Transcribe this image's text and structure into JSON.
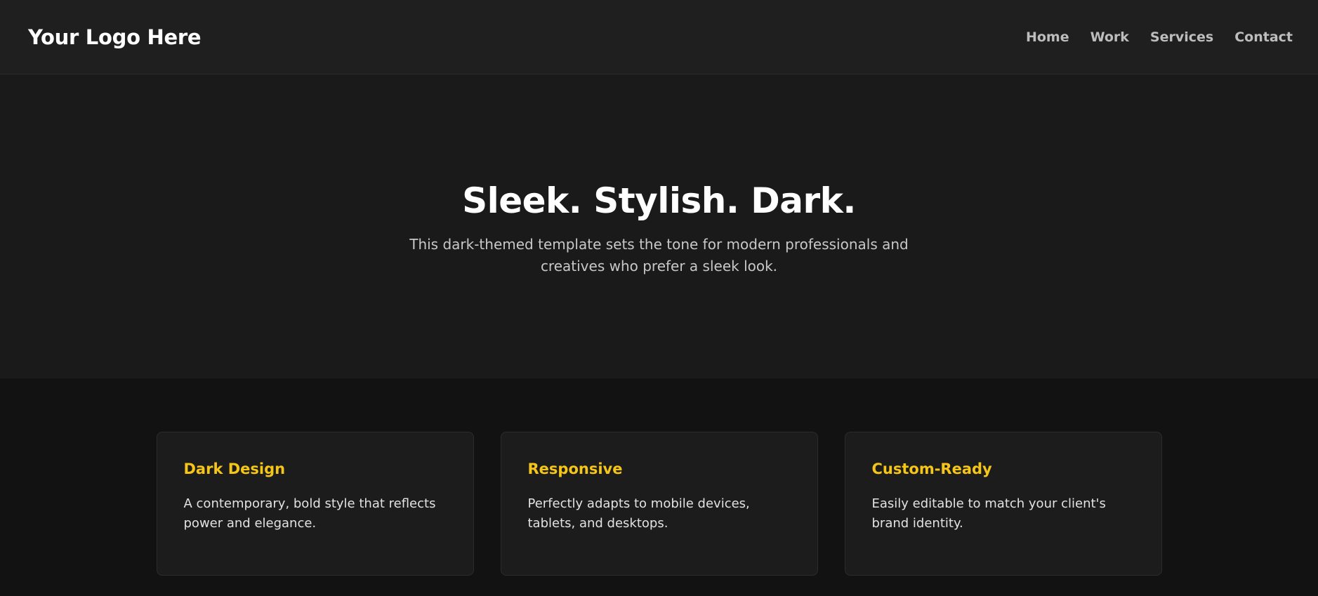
{
  "header": {
    "logo": "Your Logo Here",
    "nav": [
      {
        "label": "Home"
      },
      {
        "label": "Work"
      },
      {
        "label": "Services"
      },
      {
        "label": "Contact"
      }
    ]
  },
  "hero": {
    "title": "Sleek. Stylish. Dark.",
    "subtitle": "This dark-themed template sets the tone for modern professionals and creatives who prefer a sleek look."
  },
  "features": [
    {
      "title": "Dark Design",
      "text": "A contemporary, bold style that reflects power and elegance."
    },
    {
      "title": "Responsive",
      "text": "Perfectly adapts to mobile devices, tablets, and desktops."
    },
    {
      "title": "Custom-Ready",
      "text": "Easily editable to match your client's brand identity."
    }
  ],
  "colors": {
    "accent": "#f5c518",
    "header_bg": "#1f1f1f",
    "hero_bg": "#1a1a1a",
    "page_bg": "#121212"
  }
}
